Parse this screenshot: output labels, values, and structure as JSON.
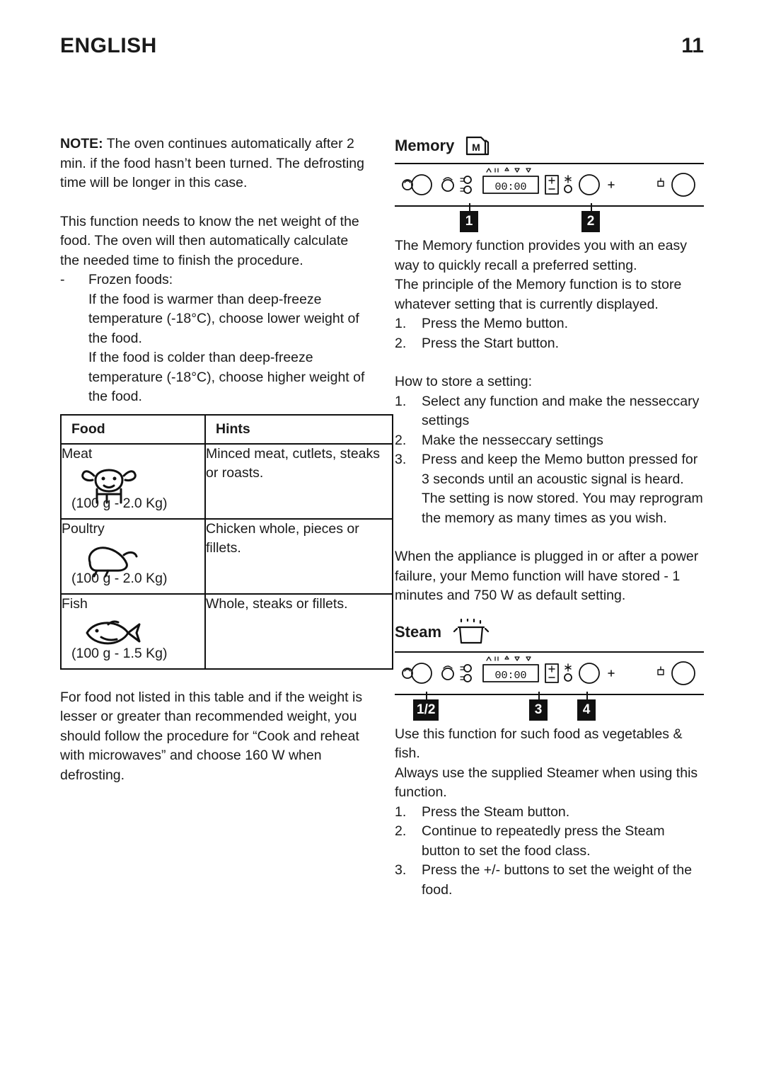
{
  "header": {
    "title": "ENGLISH",
    "page_number": "11"
  },
  "left_column": {
    "note_label": "NOTE:",
    "note_text": " The oven continues automatically after 2 min. if the food hasn’t been turned. The defrosting time will be longer in this case.",
    "paragraph_1": "This function needs to know the net weight of the food. The oven will then automatically calculate the needed time to finish the procedure.",
    "dash_item": "Frozen foods:",
    "indent_1": "If the food is warmer than deep-freeze temperature (-18°C), choose lower weight of the food.",
    "indent_2": "If the food is colder than deep-freeze temperature (-18°C), choose higher weight of the food.",
    "table": {
      "headers": [
        "Food",
        "Hints"
      ],
      "rows": [
        {
          "name": "Meat",
          "range": "(100 g - 2.0 Kg)",
          "icon": "cow-icon",
          "hint": "Minced meat, cutlets, steaks or roasts."
        },
        {
          "name": "Poultry",
          "range": "(100 g - 2.0 Kg)",
          "icon": "chicken-icon",
          "hint": "Chicken whole, pieces or fillets."
        },
        {
          "name": "Fish",
          "range": "(100 g - 1.5 Kg)",
          "icon": "fish-icon",
          "hint": "Whole, steaks or fillets."
        }
      ]
    },
    "paragraph_2": "For food not listed in this table and if the weight is lesser or greater than recommended weight, you should follow the procedure for “Cook and reheat with microwaves” and choose 160 W when defrosting."
  },
  "right_column": {
    "memory": {
      "heading": "Memory",
      "heading_icon": "memory-m-icon",
      "panel_icon": "control-panel-diagram",
      "display_value": "00:00",
      "callouts": [
        "1",
        "2"
      ],
      "paragraph_1": "The Memory function provides you with an easy way to quickly recall a preferred setting.",
      "paragraph_2": "The principle of the Memory function is to store whatever setting that is currently displayed.",
      "steps_1": [
        {
          "num": "1.",
          "text": "Press the Memo button."
        },
        {
          "num": "2.",
          "text": "Press the Start button."
        }
      ],
      "store_heading": "How to store a setting:",
      "steps_2": [
        {
          "num": "1.",
          "text": "Select any function and make the nesseccary settings"
        },
        {
          "num": "2.",
          "text": "Make the nesseccary settings"
        },
        {
          "num": "3.",
          "text": "Press and keep the Memo button pressed for 3 seconds until an acoustic signal is heard. The setting is now stored. You may reprogram the memory as many times as you wish."
        }
      ],
      "paragraph_3": "When the appliance is plugged in or after a power failure, your Memo function will have stored - 1 minutes and 750 W as default setting."
    },
    "steam": {
      "heading": "Steam",
      "heading_icon": "steamer-pot-icon",
      "panel_icon": "control-panel-diagram",
      "display_value": "00:00",
      "callouts": [
        "1/2",
        "3",
        "4"
      ],
      "paragraph_1": "Use this function for such food as vegetables & fish.",
      "paragraph_2": "Always use the supplied Steamer when using this function.",
      "steps": [
        {
          "num": "1.",
          "text": "Press the Steam button."
        },
        {
          "num": "2.",
          "text": "Continue to repeatedly press the Steam button to set the food class."
        },
        {
          "num": "3.",
          "text": "Press the +/- buttons to set the weight of the food."
        }
      ]
    }
  }
}
